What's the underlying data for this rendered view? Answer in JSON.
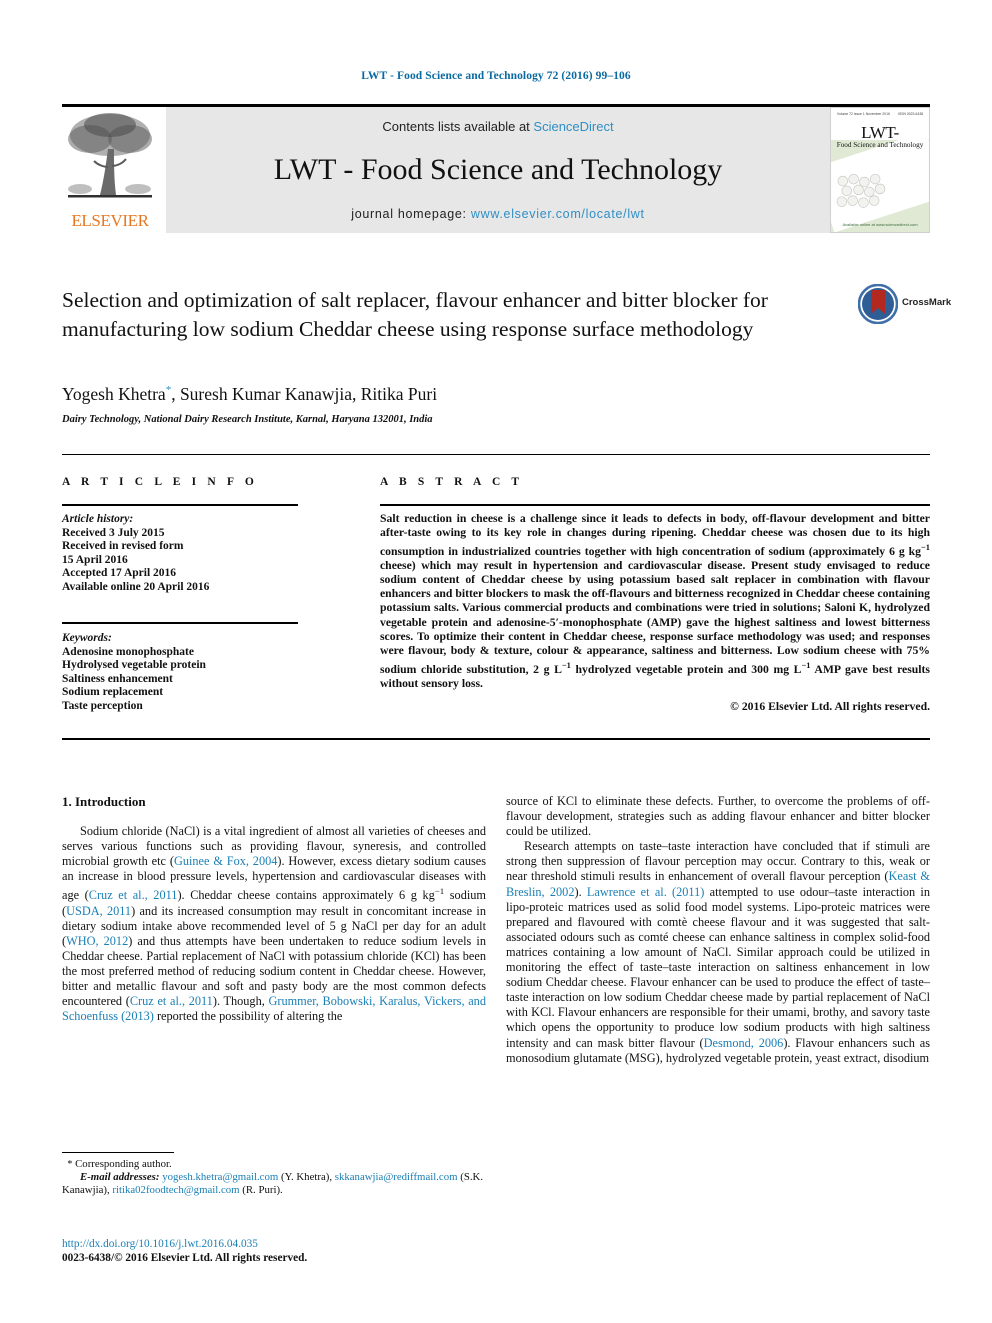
{
  "running_head": "LWT - Food Science and Technology 72 (2016) 99–106",
  "masthead": {
    "publisher_name": "ELSEVIER",
    "contents_prefix": "Contents lists available at ",
    "contents_link": "ScienceDirect",
    "journal_title": "LWT - Food Science and Technology",
    "homepage_prefix": "journal homepage: ",
    "homepage_url": "www.elsevier.com/locate/lwt",
    "cover": {
      "title": "LWT-",
      "subtitle": "Food Science and Technology",
      "top_left_meta": "Volume 72 Issue 1 November 2016",
      "top_right_meta": "ISSN 0023-6438",
      "footer": "Available online at www.sciencedirect.com"
    }
  },
  "article": {
    "title": "Selection and optimization of salt replacer, flavour enhancer and bitter blocker for manufacturing low sodium Cheddar cheese using response surface methodology",
    "authors": "Yogesh Khetra, Suresh Kumar Kanawjia, Ritika Puri",
    "author_marker": "*",
    "affiliation": "Dairy Technology, National Dairy Research Institute, Karnal, Haryana 132001, India",
    "crossmark_label": "CrossMark"
  },
  "article_info": {
    "heading": "A R T I C L E  I N F O",
    "history_label": "Article history:",
    "history": [
      "Received 3 July 2015",
      "Received in revised form",
      "15 April 2016",
      "Accepted 17 April 2016",
      "Available online 20 April 2016"
    ],
    "keywords_label": "Keywords:",
    "keywords": [
      "Adenosine monophosphate",
      "Hydrolysed vegetable protein",
      "Saltiness enhancement",
      "Sodium replacement",
      "Taste perception"
    ]
  },
  "abstract": {
    "heading": "A B S T R A C T",
    "text_1": "Salt reduction in cheese is a challenge since it leads to defects in body, off-flavour development and bitter after-taste owing to its key role in changes during ripening. Cheddar cheese was chosen due to its high consumption in industrialized countries together with high concentration of sodium (approximately 6 g kg",
    "sup_1": "−1",
    "text_2": " cheese) which may result in hypertension and cardiovascular disease. Present study envisaged to reduce sodium content of Cheddar cheese by using potassium based salt replacer in combination with flavour enhancers and bitter blockers to mask the off-flavours and bitterness recognized in Cheddar cheese containing potassium salts. Various commercial products and combinations were tried in solutions; Saloni K, hydrolyzed vegetable protein and adenosine-5′-monophosphate (AMP) gave the highest saltiness and lowest bitterness scores. To optimize their content in Cheddar cheese, response surface methodology was used; and responses were flavour, body & texture, colour & appearance, saltiness and bitterness. Low sodium cheese with 75% sodium chloride substitution, 2 g L",
    "sup_2": "−1",
    "text_3": " hydrolyzed vegetable protein and 300 mg L",
    "sup_3": "−1",
    "text_4": " AMP gave best results without sensory loss.",
    "copyright": "© 2016 Elsevier Ltd. All rights reserved."
  },
  "body": {
    "section_heading": "1. Introduction",
    "left_paragraph_1": {
      "t1": "Sodium chloride (NaCl) is a vital ingredient of almost all varieties of cheeses and serves various functions such as providing flavour, syneresis, and controlled microbial growth etc (",
      "c1": "Guinee & Fox, 2004",
      "t2": "). However, excess dietary sodium causes an increase in blood pressure levels, hypertension and cardiovascular diseases with age (",
      "c2": "Cruz et al., 2011",
      "t3": "). Cheddar cheese contains approximately 6 g kg",
      "sup1": "−1",
      "t4": " sodium (",
      "c3": "USDA, 2011",
      "t5": ") and its increased consumption may result in concomitant increase in dietary sodium intake above recommended level of 5 g NaCl per day for an adult (",
      "c4": "WHO, 2012",
      "t6": ") and thus attempts have been undertaken to reduce sodium levels in Cheddar cheese. Partial replacement of NaCl with potassium chloride (KCl) has been the most preferred method of reducing sodium content in Cheddar cheese. However, bitter and metallic flavour and soft and pasty body are the most common defects encountered (",
      "c5": "Cruz et al., 2011",
      "t7": "). Though, ",
      "c6": "Grummer, Bobowski, Karalus, Vickers, and Schoenfuss (2013)",
      "t8": " reported the possibility of altering the"
    },
    "right_paragraph_1": {
      "t1": "source of KCl to eliminate these defects. Further, to overcome the problems of off-flavour development, strategies such as adding flavour enhancer and bitter blocker could be utilized."
    },
    "right_paragraph_2": {
      "t1": "Research attempts on taste–taste interaction have concluded that if stimuli are strong then suppression of flavour perception may occur. Contrary to this, weak or near threshold stimuli results in enhancement of overall flavour perception (",
      "c1": "Keast & Breslin, 2002",
      "t2": "). ",
      "c2": "Lawrence et al. (2011)",
      "t3": " attempted to use odour–taste interaction in lipo-proteic matrices used as solid food model systems. Lipo-proteic matrices were prepared and flavoured with comtè cheese flavour and it was suggested that salt-associated odours such as comté cheese can enhance saltiness in complex solid-food matrices containing a low amount of NaCl. Similar approach could be utilized in monitoring the effect of taste–taste interaction on saltiness enhancement in low sodium Cheddar cheese. Flavour enhancer can be used to produce the effect of taste–taste interaction on low sodium Cheddar cheese made by partial replacement of NaCl with KCl. Flavour enhancers are responsible for their umami, brothy, and savory taste which opens the opportunity to produce low sodium products with high saltiness intensity and can mask bitter flavour (",
      "c3": "Desmond, 2006",
      "t4": "). Flavour enhancers such as monosodium glutamate (MSG), hydrolyzed vegetable protein, yeast extract, disodium"
    }
  },
  "footnote": {
    "corresponding": "Corresponding author.",
    "email_label": "E-mail addresses:",
    "email_1": "yogesh.khetra@gmail.com",
    "email_1_name": " (Y. Khetra), ",
    "email_2": "skkanawjia@rediffmail.com",
    "email_2_name": " (S.K. Kanawjia), ",
    "email_3": "ritika02foodtech@gmail.com",
    "email_3_name": " (R. Puri).",
    "doi": "http://dx.doi.org/10.1016/j.lwt.2016.04.035",
    "issn_line": "0023-6438/© 2016 Elsevier Ltd. All rights reserved."
  },
  "colors": {
    "link": "#1a7fb5",
    "running_head": "#0a6aa1",
    "elsevier_orange": "#E87722",
    "banner_bg": "#e7e7e7"
  }
}
